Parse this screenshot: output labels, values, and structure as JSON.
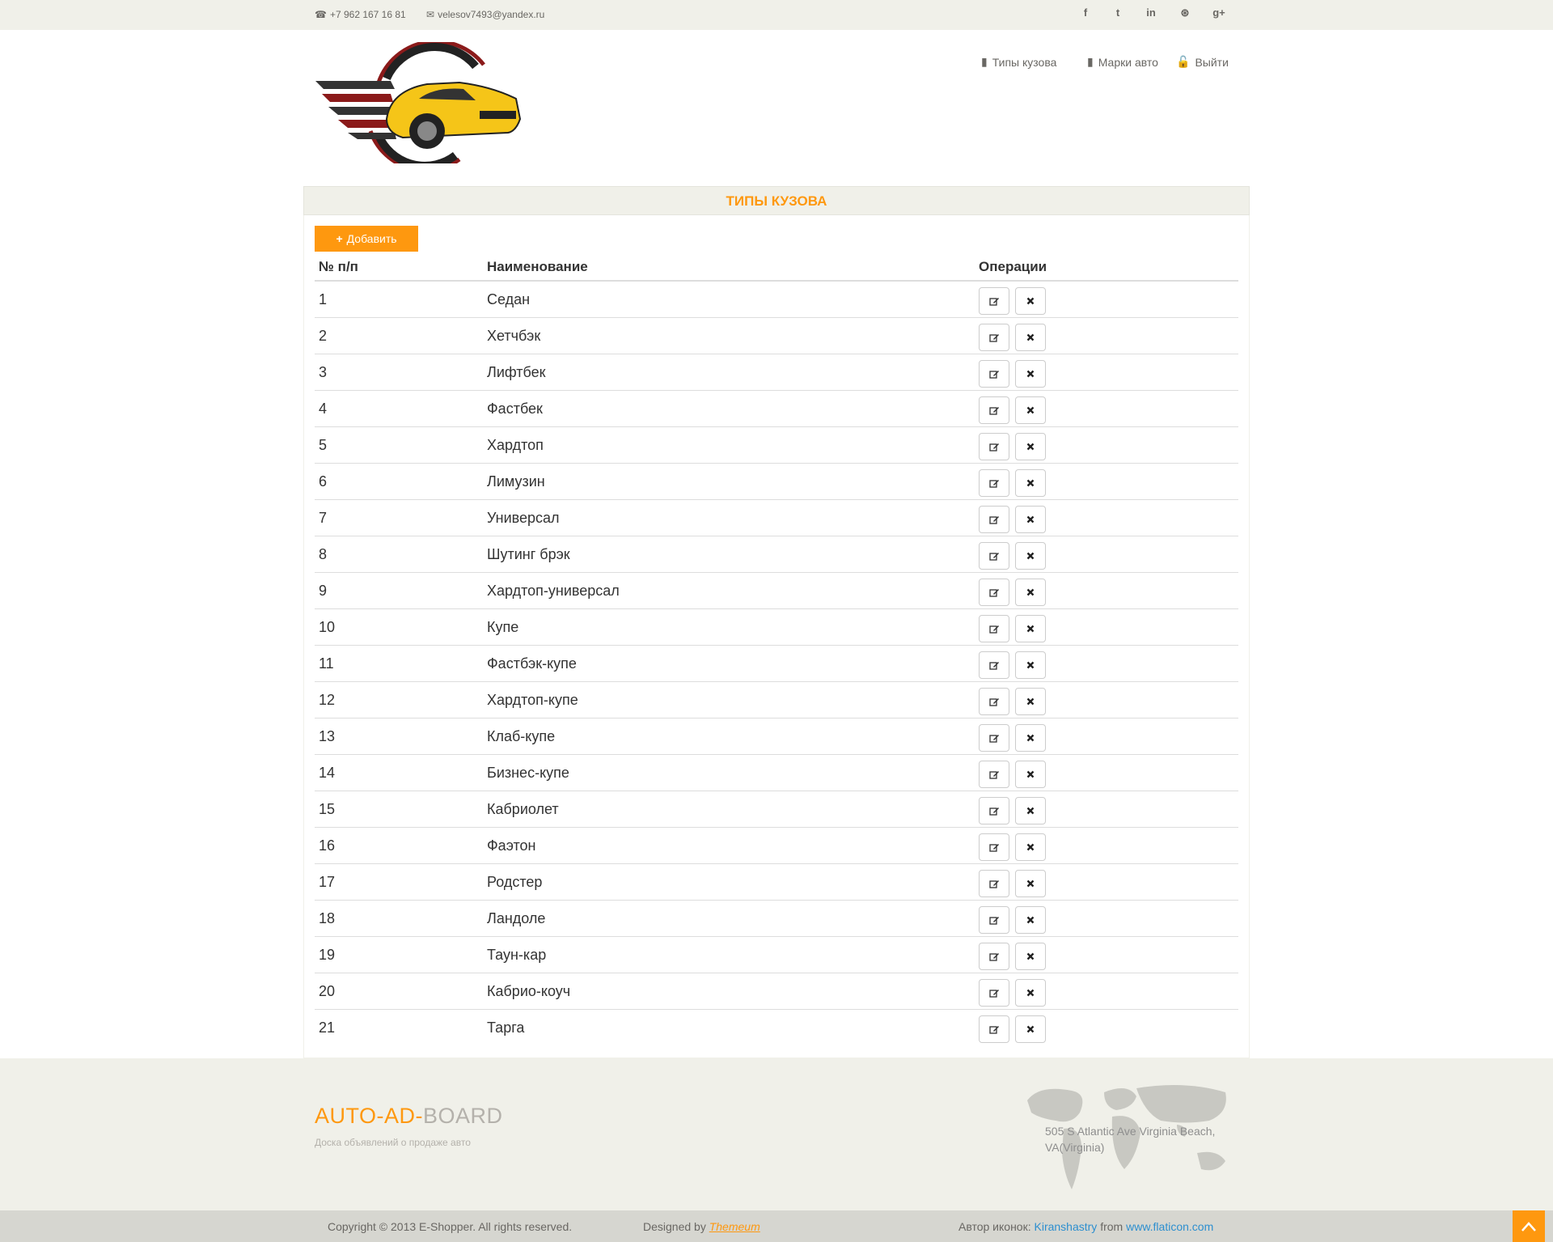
{
  "topbar": {
    "phone": "+7 962 167 16 81",
    "email": "velesov7493@yandex.ru",
    "social": [
      "facebook-icon",
      "twitter-icon",
      "linkedin-icon",
      "dribbble-icon",
      "google-plus-icon"
    ],
    "social_glyphs": [
      "f",
      "t",
      "in",
      "⊛",
      "g+"
    ]
  },
  "nav": {
    "items": [
      {
        "label": "Типы кузова",
        "icon": "book-icon"
      },
      {
        "label": "Марки авто",
        "icon": "book-icon"
      },
      {
        "label": "Выйти",
        "icon": "unlock-icon"
      }
    ]
  },
  "panel": {
    "title": "ТИПЫ КУЗОВА",
    "add_label": "Добавить"
  },
  "table": {
    "headers": [
      "№ п/п",
      "Наименование",
      "Операции"
    ],
    "rows": [
      [
        "1",
        "Седан"
      ],
      [
        "2",
        "Хетчбэк"
      ],
      [
        "3",
        "Лифтбек"
      ],
      [
        "4",
        "Фастбек"
      ],
      [
        "5",
        "Хардтоп"
      ],
      [
        "6",
        "Лимузин"
      ],
      [
        "7",
        "Универсал"
      ],
      [
        "8",
        "Шутинг брэк"
      ],
      [
        "9",
        "Хардтоп-универсал"
      ],
      [
        "10",
        "Купе"
      ],
      [
        "11",
        "Фастбэк-купе"
      ],
      [
        "12",
        "Хардтоп-купе"
      ],
      [
        "13",
        "Клаб-купе"
      ],
      [
        "14",
        "Бизнес-купе"
      ],
      [
        "15",
        "Кабриолет"
      ],
      [
        "16",
        "Фаэтон"
      ],
      [
        "17",
        "Родстер"
      ],
      [
        "18",
        "Ландоле"
      ],
      [
        "19",
        "Таун-кар"
      ],
      [
        "20",
        "Кабрио-коуч"
      ],
      [
        "21",
        "Тарга"
      ]
    ]
  },
  "footer": {
    "brand_part1": "AUTO-AD-",
    "brand_part2": "BOARD",
    "tagline": "Доска объявлений о продаже авто",
    "address": "505 S Atlantic Ave Virginia Beach, VA(Virginia)"
  },
  "bottom": {
    "copyright": "Copyright © 2013 E-Shopper. All rights reserved.",
    "designed_by": "Designed by",
    "designer": "Themeum",
    "icons_author_prefix": "Автор иконок:",
    "icons_author": "Kiranshastry",
    "from": "from",
    "site": "www.flaticon.com"
  },
  "colors": {
    "accent": "#fe980f",
    "bar": "#f0f0e9",
    "link": "#2d8fcf"
  }
}
